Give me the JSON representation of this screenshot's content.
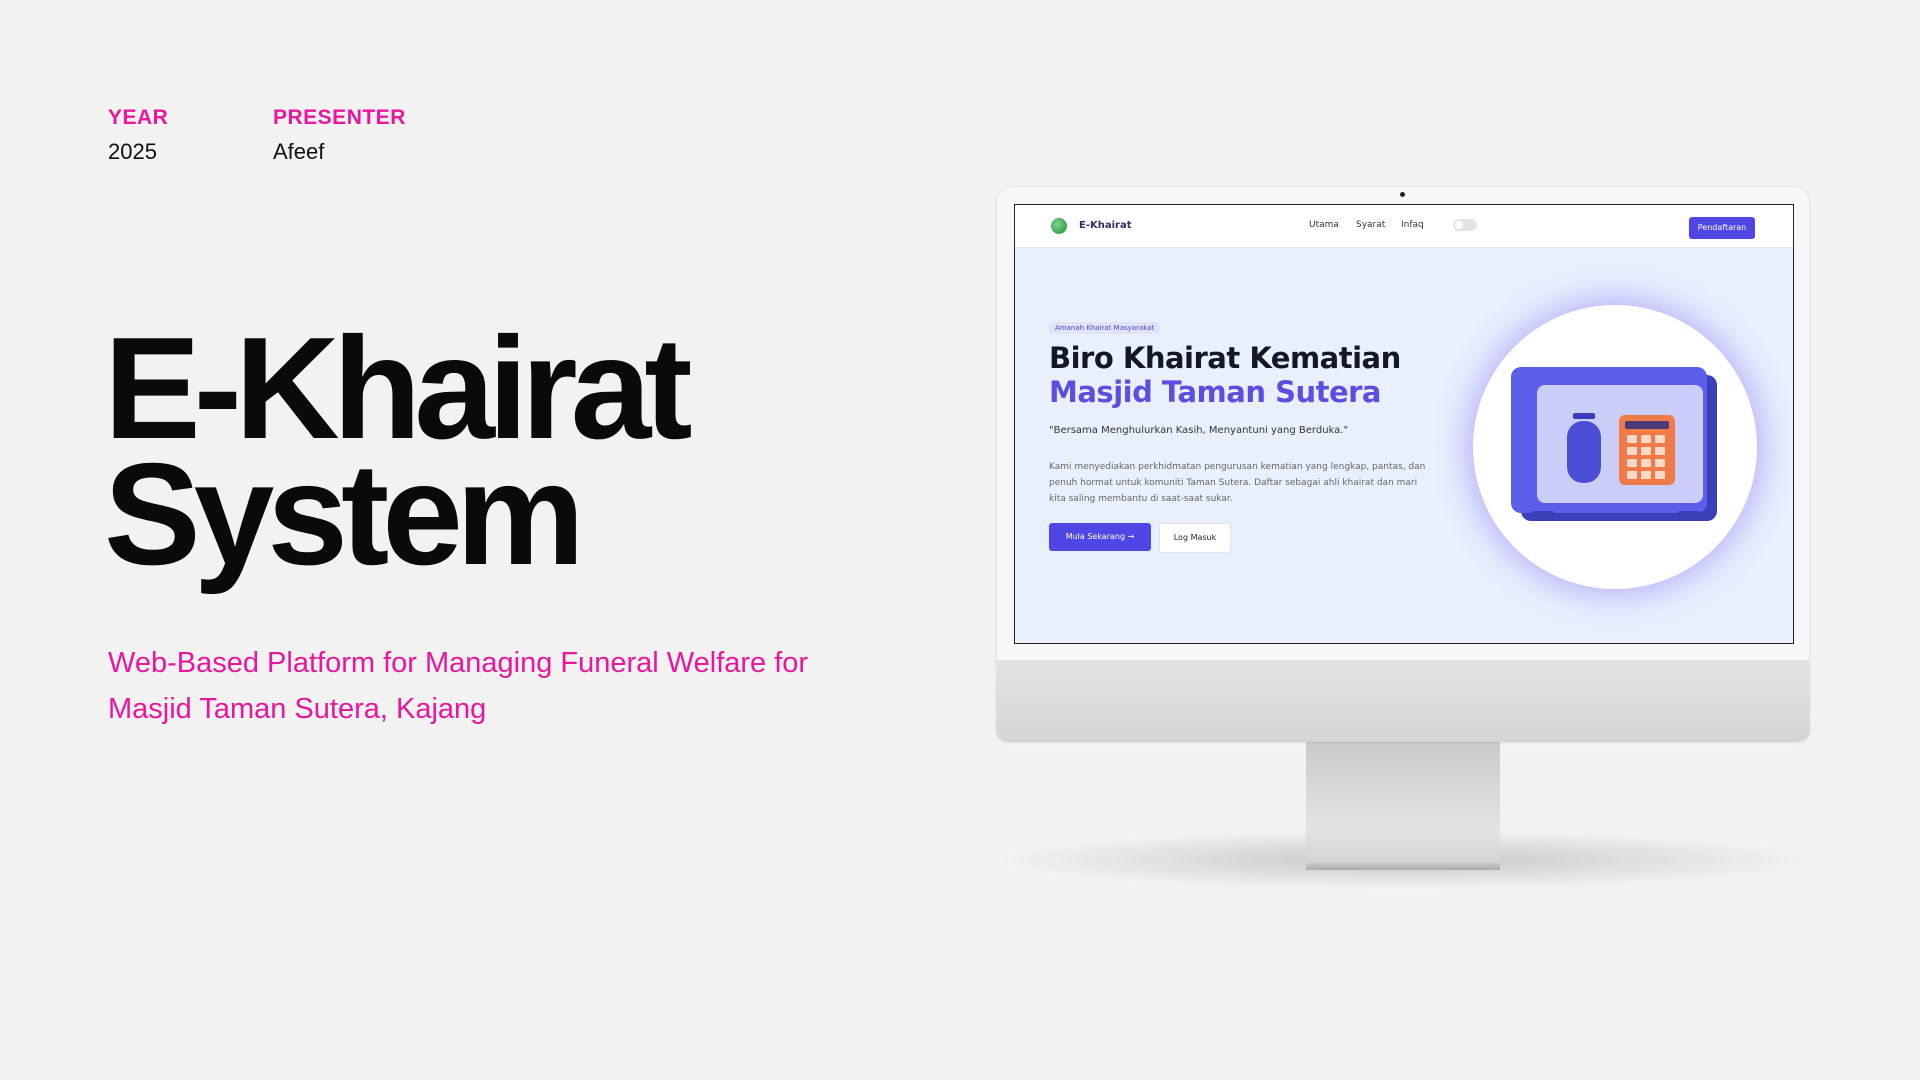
{
  "meta": {
    "year_label": "YEAR",
    "year_value": "2025",
    "presenter_label": "PRESENTER",
    "presenter_value": "Afeef"
  },
  "title": {
    "line1": "E-Khairat",
    "line2": "System"
  },
  "subtitle": "Web-Based Platform for Managing Funeral Welfare for Masjid Taman Sutera, Kajang",
  "colors": {
    "accent": "#e9179d",
    "primary": "#4f46e5",
    "hero_bg": "#e8f0fd"
  },
  "screen": {
    "nav": {
      "brand": "E-Khairat",
      "links": [
        "Utama",
        "Syarat",
        "Infaq"
      ],
      "cta": "Pendaftaran",
      "logo_icon": "leaf-logo-icon",
      "toggle_icon": "theme-toggle-icon"
    },
    "hero": {
      "badge": "Amanah Khairat Masyarakat",
      "heading_line1": "Biro Khairat Kematian",
      "heading_line2": "Masjid Taman Sutera",
      "quote": "\"Bersama Menghulurkan Kasih, Menyantuni yang Berduka.\"",
      "description": "Kami menyediakan perkhidmatan pengurusan kematian yang lengkap, pantas, dan penuh hormat untuk komuniti Taman Sutera. Daftar sebagai ahli khairat dan mari kita saling membantu di saat-saat sukar.",
      "primary_button": "Mula Sekarang",
      "secondary_button": "Log Masuk",
      "illustration_icon": "safe-illustration-icon"
    }
  }
}
